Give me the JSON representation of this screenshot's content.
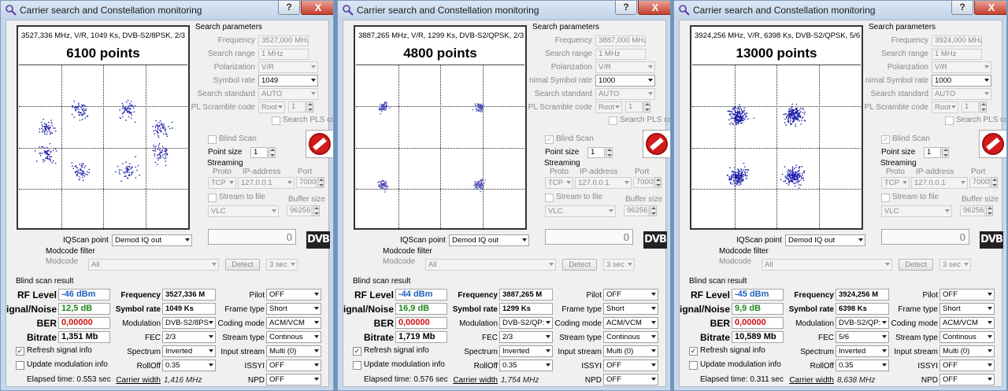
{
  "windows": [
    {
      "title": "Carrier search and Constellation monitoring",
      "plot_header": "3527,336 MHz, V/R, 1049 Ks, DVB-S2/8PSK, 2/3",
      "points_label": "6100 points",
      "constellation": "8psk",
      "params": {
        "frequency": "3527,000 MHz",
        "search_range": "1 MHz",
        "polarization": "V/R",
        "symbol_rate_label": "Symbol rate",
        "symbol_rate": "1049",
        "search_standard": "AUTO",
        "pl_scramble_mode": "Root",
        "pl_scramble_value": "1"
      },
      "blind_scan_checked": false,
      "point_size": "1",
      "streaming": {
        "proto": "TCP",
        "ip": "127.0.0.1",
        "port": "7000",
        "player": "VLC",
        "buffer": "96256",
        "stream_to_file": false
      },
      "iqscan_point": "Demod IQ out",
      "modcode": "All",
      "result": {
        "rf_level": "-46 dBm",
        "snr": "12,5 dB",
        "ber": "0,00000",
        "bitrate": "1,351 Mb",
        "frequency": "3527,336 M",
        "symbol_rate": "1049 Ks",
        "modulation": "DVB-S2/8PS",
        "fec": "2/3",
        "spectrum": "Inverted",
        "rolloff": "0.35",
        "carrier_width": "1,416 MHz",
        "pilot": "OFF",
        "frame_type": "Short",
        "coding_mode": "ACM/VCM",
        "stream_type": "Continous",
        "input_stream": "Multi (0)",
        "issyi": "OFF",
        "npd": "OFF"
      },
      "refresh_checked": true,
      "update_modulation_checked": false,
      "elapsed": "Elapsed time: 0.553 sec"
    },
    {
      "title": "Carrier search and Constellation monitoring",
      "plot_header": "3887,265 MHz, V/R, 1299 Ks, DVB-S2/QPSK, 2/3",
      "points_label": "4800 points",
      "constellation": "qpsk_tight",
      "params": {
        "frequency": "3887,000 MHz",
        "search_range": "1 MHz",
        "polarization": "V/R",
        "symbol_rate_label": "nimal Symbol rate",
        "symbol_rate": "1000",
        "search_standard": "AUTO",
        "pl_scramble_mode": "Root",
        "pl_scramble_value": "1"
      },
      "blind_scan_checked": true,
      "point_size": "1",
      "streaming": {
        "proto": "TCP",
        "ip": "127.0.0.1",
        "port": "7000",
        "player": "VLC",
        "buffer": "96256",
        "stream_to_file": false
      },
      "iqscan_point": "Demod IQ out",
      "modcode": "All",
      "result": {
        "rf_level": "-44 dBm",
        "snr": "16,9 dB",
        "ber": "0,00000",
        "bitrate": "1,719 Mb",
        "frequency": "3887,265 M",
        "symbol_rate": "1299 Ks",
        "modulation": "DVB-S2/QP:",
        "fec": "2/3",
        "spectrum": "Inverted",
        "rolloff": "0.35",
        "carrier_width": "1,754 MHz",
        "pilot": "OFF",
        "frame_type": "Short",
        "coding_mode": "ACM/VCM",
        "stream_type": "Continous",
        "input_stream": "Multi (0)",
        "issyi": "OFF",
        "npd": "OFF"
      },
      "refresh_checked": true,
      "update_modulation_checked": false,
      "elapsed": "Elapsed time: 0.576 sec"
    },
    {
      "title": "Carrier search and Constellation monitoring",
      "plot_header": "3924,256 MHz, V/R, 6398 Ks, DVB-S2/QPSK, 5/6",
      "points_label": "13000 points",
      "constellation": "qpsk_wide",
      "params": {
        "frequency": "3924,000 MHz",
        "search_range": "1 MHz",
        "polarization": "V/R",
        "symbol_rate_label": "nimal Symbol rate",
        "symbol_rate": "1000",
        "search_standard": "AUTO",
        "pl_scramble_mode": "Root",
        "pl_scramble_value": "1"
      },
      "blind_scan_checked": true,
      "point_size": "1",
      "streaming": {
        "proto": "TCP",
        "ip": "127.0.0.1",
        "port": "7000",
        "player": "VLC",
        "buffer": "96256",
        "stream_to_file": false
      },
      "iqscan_point": "Demod IQ out",
      "modcode": "All",
      "result": {
        "rf_level": "-45 dBm",
        "snr": "9,9 dB",
        "ber": "0,00000",
        "bitrate": "10,589 Mb",
        "frequency": "3924,256 M",
        "symbol_rate": "6398 Ks",
        "modulation": "DVB-S2/QP:",
        "fec": "5/6",
        "spectrum": "Inverted",
        "rolloff": "0.35",
        "carrier_width": "8,638 MHz",
        "pilot": "OFF",
        "frame_type": "Short",
        "coding_mode": "ACM/VCM",
        "stream_type": "Continous",
        "input_stream": "Multi (0)",
        "issyi": "OFF",
        "npd": "OFF"
      },
      "refresh_checked": true,
      "update_modulation_checked": false,
      "elapsed": "Elapsed time: 0.311 sec"
    }
  ],
  "labels": {
    "search_parameters": "Search parameters",
    "frequency": "Frequency",
    "search_range": "Search range",
    "polarization": "Polarization",
    "search_standard": "Search standard",
    "pl_scramble": "PL Scramble code",
    "search_pls": "Search PLS cc",
    "blind_scan": "Blind Scan",
    "point_size": "Point size",
    "streaming": "Streaming",
    "proto": "Proto",
    "ip_address": "IP-address",
    "port": "Port",
    "stream_to_file": "Stream to file",
    "buffer_size": "Buffer size",
    "iqscan_point": "IQScan point",
    "modcode_filter": "Modcode filter",
    "modcode": "Modcode",
    "detect": "Detect",
    "timeout": "3 sec",
    "blind_scan_result": "Blind scan result",
    "rf_level": "RF Level",
    "snr": "ignal/Noise",
    "ber": "BER",
    "bitrate": "Bitrate",
    "frequency_r": "Frequency",
    "symbol_rate_r": "Symbol rate",
    "modulation": "Modulation",
    "fec": "FEC",
    "spectrum": "Spectrum",
    "rolloff": "RollOff",
    "carrier_width": "Carrier width",
    "pilot": "Pilot",
    "frame_type": "Frame type",
    "coding_mode": "Coding mode",
    "stream_type": "Stream type",
    "input_stream": "Input stream",
    "issyi": "ISSYI",
    "npd": "NPD",
    "refresh_signal": "Refresh signal info",
    "update_modulation": "Update modulation info",
    "help": "?",
    "close": "X",
    "display_value": "0",
    "dvb_logo": "DVB"
  },
  "colors": {
    "rf_level": "#1f5fbf",
    "snr": "#1a8a1a",
    "ber": "#d01010",
    "points": "#1a1aaa"
  }
}
